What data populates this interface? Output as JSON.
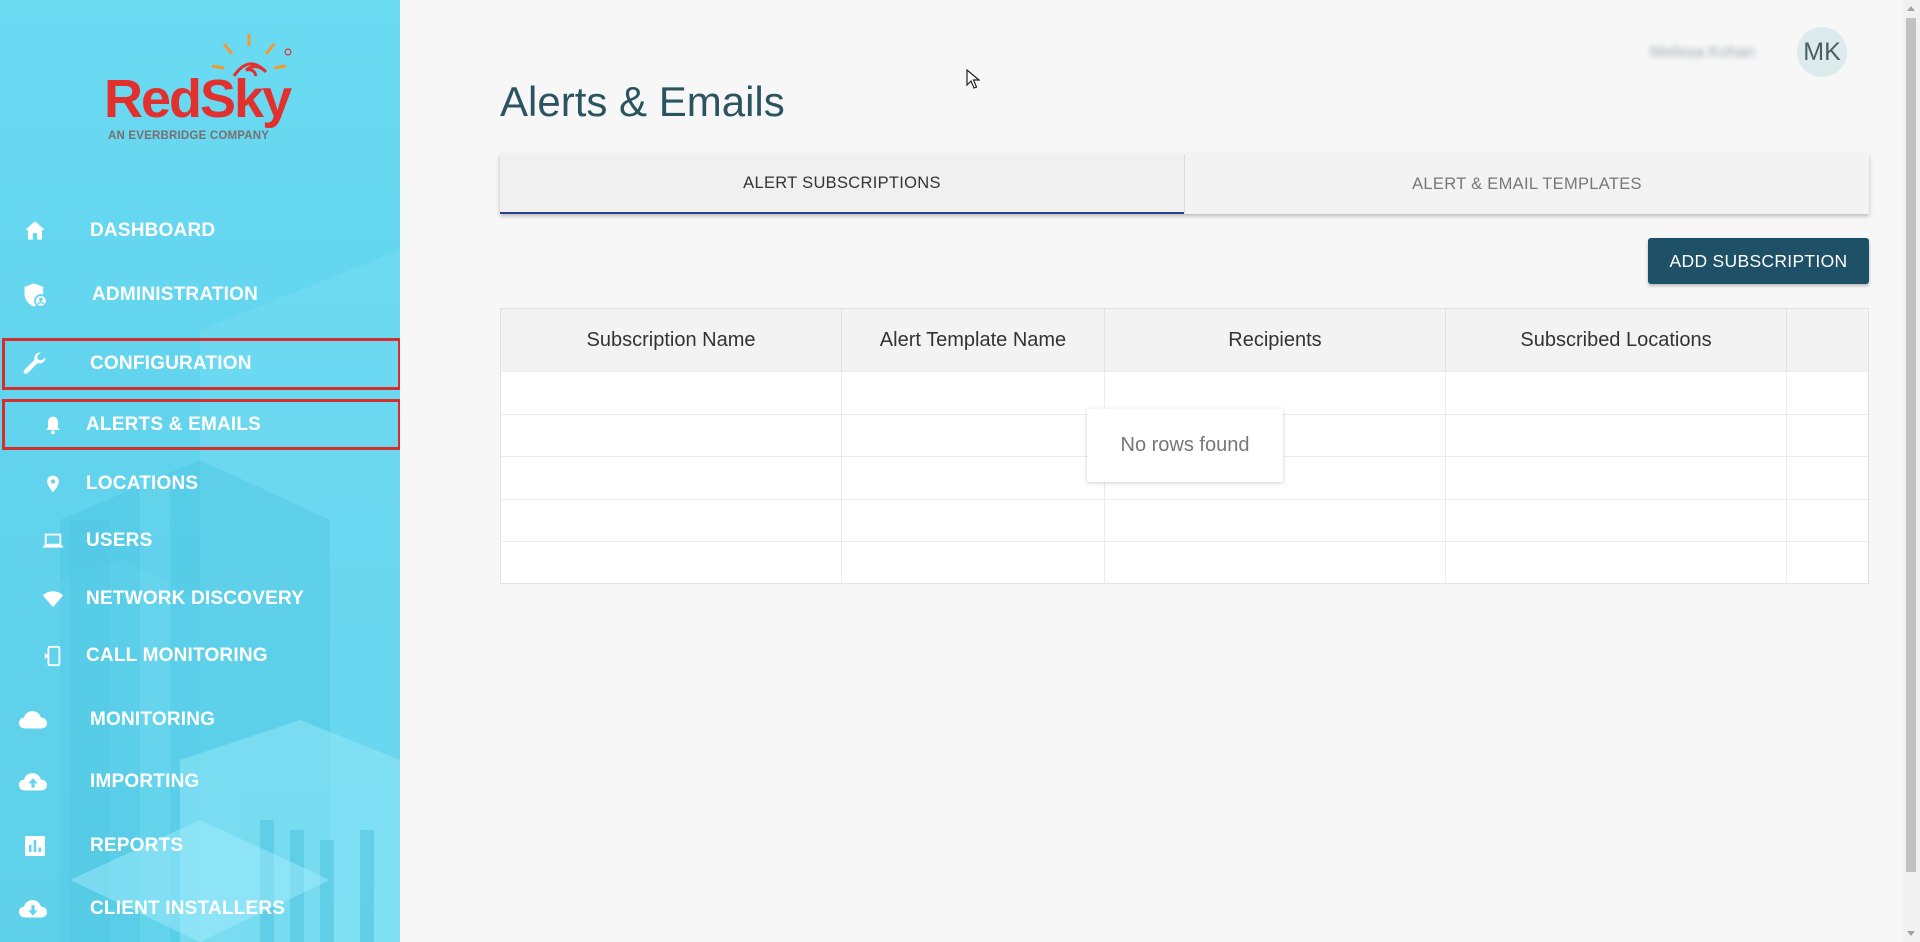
{
  "brand": {
    "name": "RedSky",
    "tagline": "AN EVERBRIDGE COMPANY"
  },
  "sidebar": {
    "items": [
      {
        "label": "DASHBOARD",
        "icon": "home-icon"
      },
      {
        "label": "ADMINISTRATION",
        "icon": "shield-user-icon"
      },
      {
        "label": "CONFIGURATION",
        "icon": "wrench-icon",
        "highlighted": true
      },
      {
        "label": "ALERTS & EMAILS",
        "icon": "bell-icon",
        "highlighted": true,
        "sub": true
      },
      {
        "label": "LOCATIONS",
        "icon": "map-pin-icon",
        "sub": true
      },
      {
        "label": "USERS",
        "icon": "laptop-icon",
        "sub": true
      },
      {
        "label": "NETWORK DISCOVERY",
        "icon": "wifi-icon",
        "sub": true
      },
      {
        "label": "CALL MONITORING",
        "icon": "phone-device-icon",
        "sub": true
      },
      {
        "label": "MONITORING",
        "icon": "cloud-icon"
      },
      {
        "label": "IMPORTING",
        "icon": "cloud-upload-icon"
      },
      {
        "label": "REPORTS",
        "icon": "bar-chart-icon"
      },
      {
        "label": "CLIENT INSTALLERS",
        "icon": "cloud-download-icon"
      }
    ]
  },
  "header": {
    "user_name": "Melissa Kohan",
    "avatar_initials": "MK"
  },
  "main": {
    "title": "Alerts & Emails",
    "tabs": [
      {
        "label": "ALERT SUBSCRIPTIONS",
        "active": true
      },
      {
        "label": "ALERT & EMAIL TEMPLATES",
        "active": false
      }
    ],
    "add_button_label": "ADD SUBSCRIPTION",
    "table": {
      "columns": [
        "Subscription Name",
        "Alert Template Name",
        "Recipients",
        "Subscribed Locations",
        ""
      ],
      "rows": [],
      "empty_message": "No rows found"
    }
  },
  "colors": {
    "sidebar_bg": "#62d4ee",
    "brand_red": "#e2302f",
    "primary_button": "#1e5068",
    "title_color": "#2c5460",
    "highlight_border": "#d32f2f"
  }
}
